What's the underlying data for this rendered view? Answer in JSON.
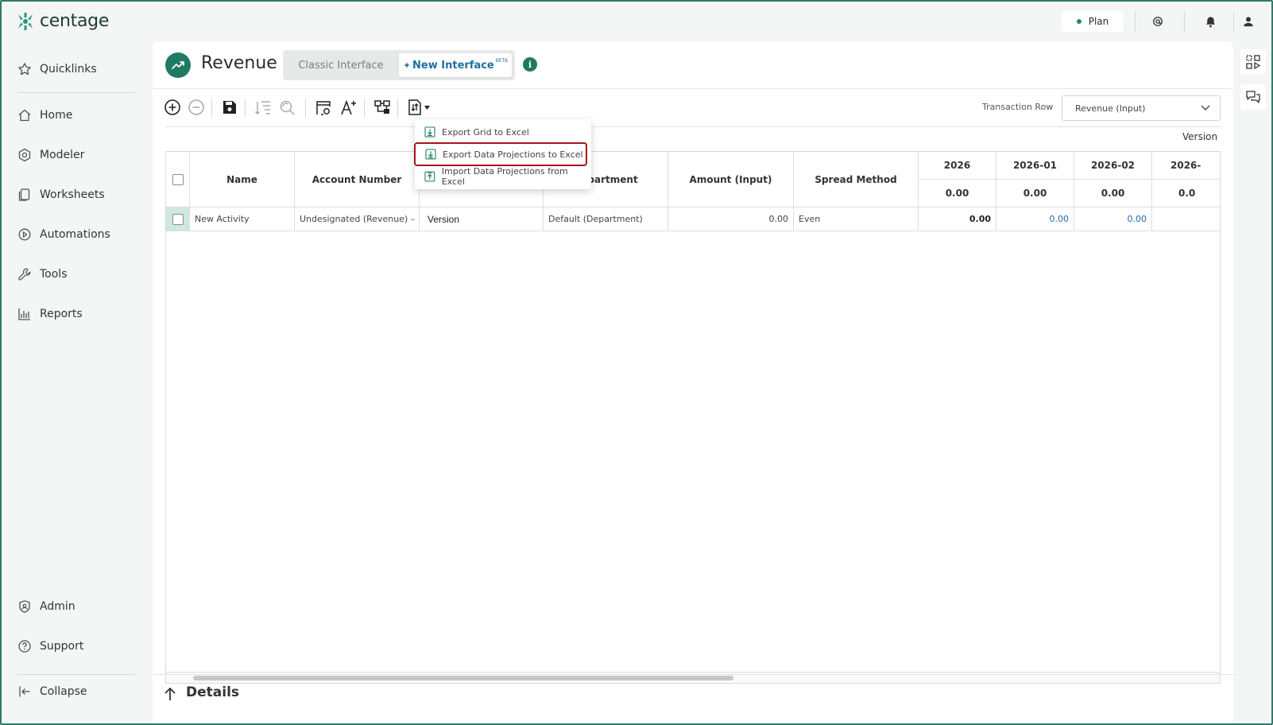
{
  "app": {
    "brand": "centage",
    "accent": "#1f7a63",
    "link_color": "#1f6fa0"
  },
  "topbar": {
    "plan_label": "Plan",
    "icons": [
      "at-sign-icon",
      "bell-icon",
      "user-icon"
    ]
  },
  "sidebar": {
    "items_top": [
      {
        "label": "Quicklinks",
        "icon": "star-icon"
      },
      {
        "label": "Home",
        "icon": "home-icon"
      },
      {
        "label": "Modeler",
        "icon": "modeler-icon"
      },
      {
        "label": "Worksheets",
        "icon": "worksheets-icon"
      },
      {
        "label": "Automations",
        "icon": "automations-icon"
      },
      {
        "label": "Tools",
        "icon": "wrench-icon"
      },
      {
        "label": "Reports",
        "icon": "reports-icon"
      }
    ],
    "items_bottom": [
      {
        "label": "Admin",
        "icon": "admin-icon"
      },
      {
        "label": "Support",
        "icon": "help-icon"
      },
      {
        "label": "Collapse",
        "icon": "collapse-icon"
      }
    ]
  },
  "page": {
    "title": "Revenue",
    "classic_label": "Classic Interface",
    "new_label": "New Interface",
    "beta_label": "BETA",
    "info_glyph": "i"
  },
  "toolbar": {
    "transaction_label": "Transaction Row",
    "transaction_value": "Revenue (Input)",
    "version_label": "Version"
  },
  "menu": {
    "items": [
      {
        "label": "Export Grid to Excel",
        "icon": "excel-export-icon"
      },
      {
        "label": "Export Data Projections to Excel",
        "icon": "excel-export-icon",
        "highlighted": true
      },
      {
        "label": "Import Data Projections from Excel",
        "icon": "excel-import-icon"
      }
    ]
  },
  "grid": {
    "columns": [
      "Name",
      "Account Number",
      "",
      "Department",
      "Amount (Input)",
      "Spread Method"
    ],
    "periods": [
      {
        "label": "2026",
        "total": "0.00"
      },
      {
        "label": "2026-01",
        "total": "0.00"
      },
      {
        "label": "2026-02",
        "total": "0.00"
      },
      {
        "label": "2026-",
        "total": "0.0"
      }
    ],
    "rows": [
      {
        "name": "New Activity",
        "account": "Undesignated (Revenue) – ...",
        "version": "Version",
        "department": "Default (Department)",
        "amount": "0.00",
        "spread": "Even",
        "p2026": "0.00",
        "p202601": "0.00",
        "p202602": "0.00"
      }
    ]
  },
  "details": {
    "label": "Details"
  }
}
